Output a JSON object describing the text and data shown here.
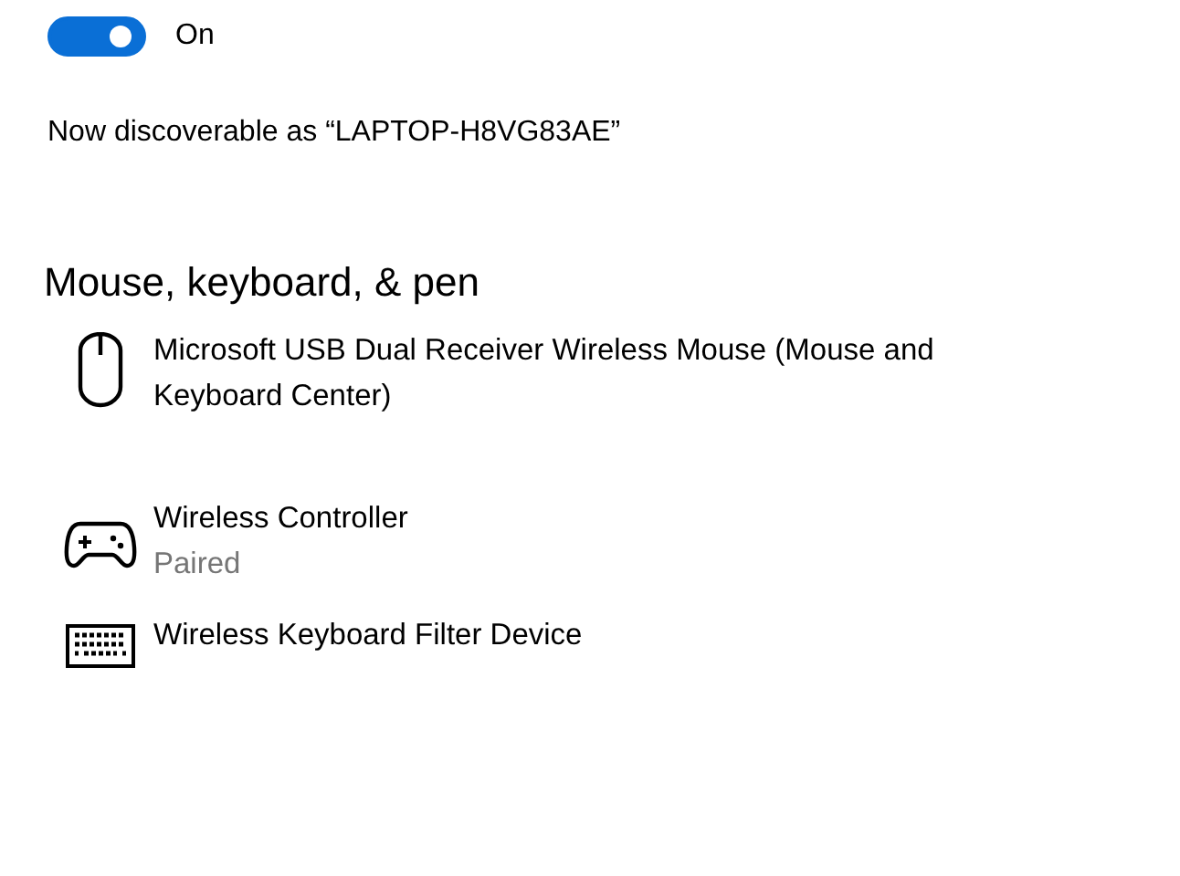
{
  "bluetooth_toggle": {
    "on": true,
    "label": "On"
  },
  "discoverable_text": "Now discoverable as “LAPTOP-H8VG83AE”",
  "section": {
    "title": "Mouse, keyboard, & pen",
    "devices": [
      {
        "kind": "mouse",
        "name": "Microsoft USB Dual Receiver Wireless Mouse (Mouse and Keyboard Center)"
      },
      {
        "kind": "gamepad",
        "name": "Wireless Controller",
        "status": "Paired"
      },
      {
        "kind": "keyboard",
        "name": "Wireless Keyboard Filter Device"
      }
    ]
  }
}
